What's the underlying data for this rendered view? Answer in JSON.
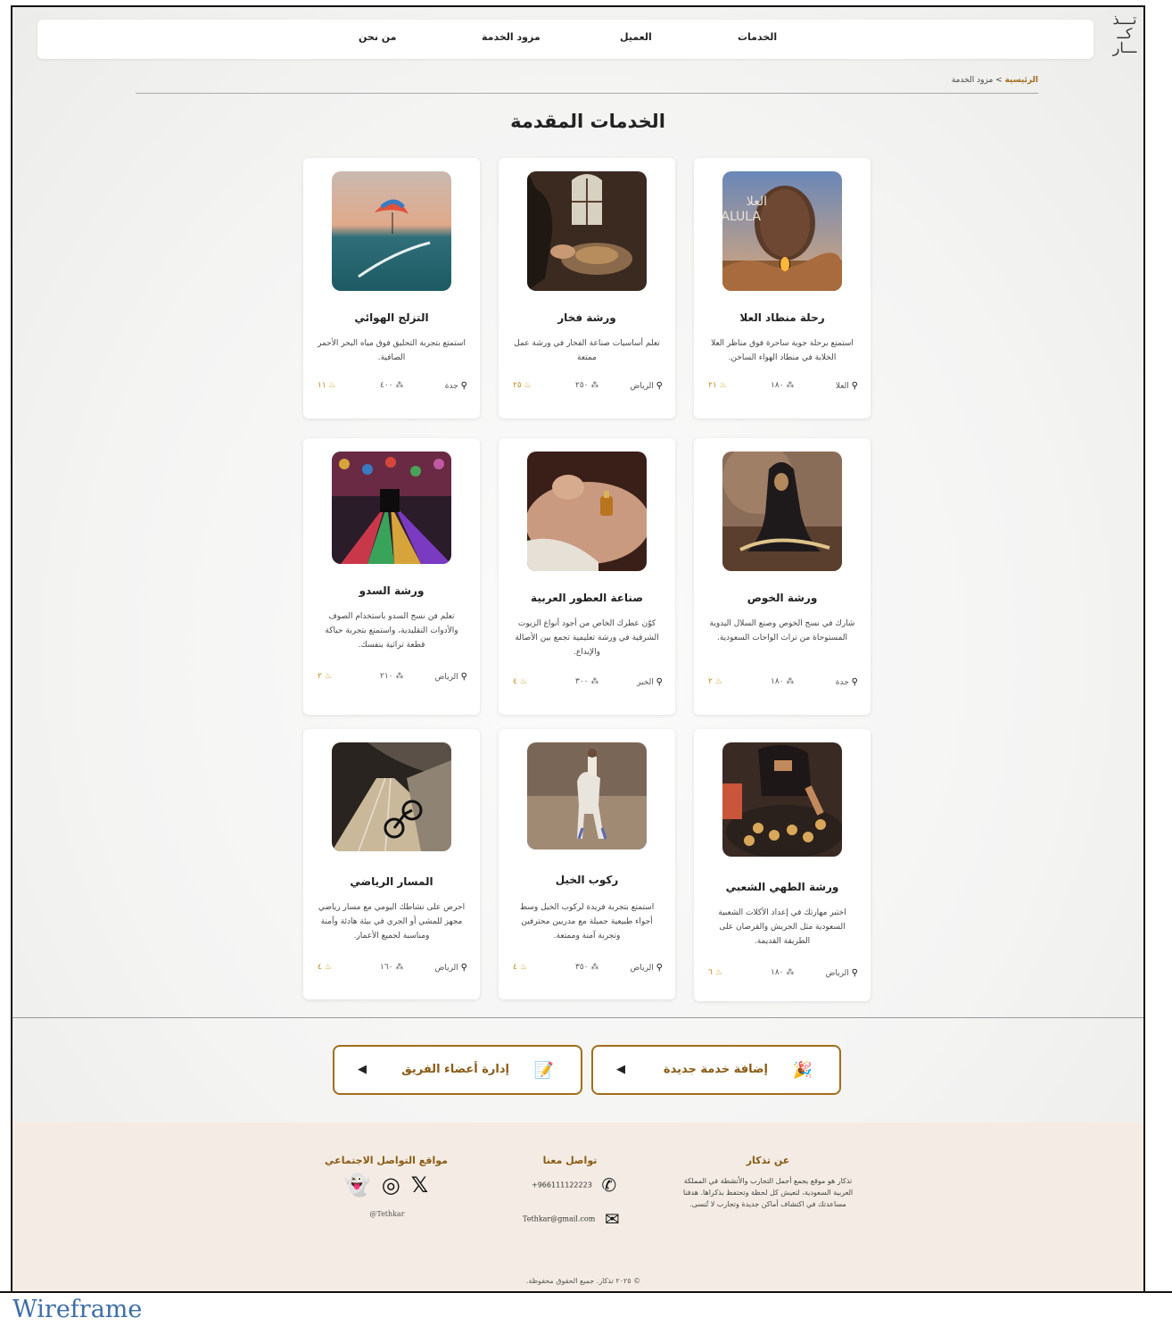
{
  "nav": {
    "items": [
      "الخدمات",
      "العميل",
      "مزود الخدمة",
      "من نحن"
    ]
  },
  "logo": {
    "line1": "تـــذ",
    "line2": "كــ",
    "line3": "ـــار"
  },
  "breadcrumb": {
    "home": "الرئيسية",
    "separator": ">",
    "current": "مزود الخدمة"
  },
  "page_title": "الخدمات المقدمة",
  "cards": [
    {
      "title": "رحلة منطاد العلا",
      "desc": "استمتع برحلة جوية ساحرة فوق مناظر العلا الخلابة في منطاد الهواء الساخن.",
      "location": "العلا",
      "price": "١٨٠",
      "rating": "٢١"
    },
    {
      "title": "ورشة فخار",
      "desc": "تعلم أساسيات صناعة الفخار في ورشة عمل ممتعة",
      "location": "الرياض",
      "price": "٢٥٠",
      "rating": "٢٥"
    },
    {
      "title": "التزلج الهوائي",
      "desc": "استمتع بتجربة التحليق فوق مياه البحر الأحمر الصافية.",
      "location": "جدة",
      "price": "٤٠٠",
      "rating": "١١"
    },
    {
      "title": "ورشة الخوص",
      "desc": "شارك في نسج الخوص وصنع السلال اليدوية المستوحاة من تراث الواحات السعودية.",
      "location": "جدة",
      "price": "١٨٠",
      "rating": "٢"
    },
    {
      "title": "صناعة العطور العربية",
      "desc": "كوّن عطرك الخاص من أجود أنواع الزيوت الشرقية في ورشة تعليمية تجمع بين الأصالة والإبداع.",
      "location": "الخبر",
      "price": "٣٠٠",
      "rating": "٤"
    },
    {
      "title": "ورشة السدو",
      "desc": "تعلم فن نسج السدو باستخدام الصوف والأدوات التقليدية، واستمتع بتجربة حياكة قطعة تراثية بنفسك.",
      "location": "الرياض",
      "price": "٢١٠",
      "rating": "٢"
    },
    {
      "title": "ورشة الطهي الشعبي",
      "desc": "اختبر مهارتك في إعداد الأكلات الشعبية السعودية مثل الجريش والقرصان على الطريقة القديمة.",
      "location": "الرياض",
      "price": "١٨٠",
      "rating": "٦"
    },
    {
      "title": "ركوب الخيل",
      "desc": "استمتع بتجربة فريدة لركوب الخيل وسط أجواء طبيعية جميلة مع مدربين محترفين وتجربة آمنة وممتعة.",
      "location": "الرياض",
      "price": "٣٥٠",
      "rating": "٤"
    },
    {
      "title": "المسار الرياضي",
      "desc": "احرص على نشاطك اليومي مع مسار رياضي مجهز للمشي أو الجري في بيئة هادئة وآمنة ومناسبة لجميع الأعمار.",
      "location": "الرياض",
      "price": "١٦٠",
      "rating": "٤"
    }
  ],
  "actions": {
    "add_service": "إضافة خدمة جديدة",
    "manage_team": "إدارة أعضاء الفريق"
  },
  "footer": {
    "about_title": "عن تذكار",
    "about_text": "تذكار هو موقع يجمع أجمل التجارب والأنشطة في المملكة العربية السعودية، لتعيش كل لحظة وتحتفظ بذكراها. هدفنا مساعدتك في اكتشاف أماكن جديدة وتجارب لا تُنسى.",
    "contact_title": "تواصل معنا",
    "phone": "+966111122223",
    "email": "Tethkar@gmail.com",
    "social_title": "مواقع التواصل الاجتماعي",
    "social_handle": "@Tethkar",
    "copyright": "© ٢٠٢٥ تذكار. جميع الحقوق محفوظة."
  },
  "caption": "Wireframe",
  "colors": {
    "accent": "#a26d1c",
    "footer_bg": "#f4ece4"
  }
}
